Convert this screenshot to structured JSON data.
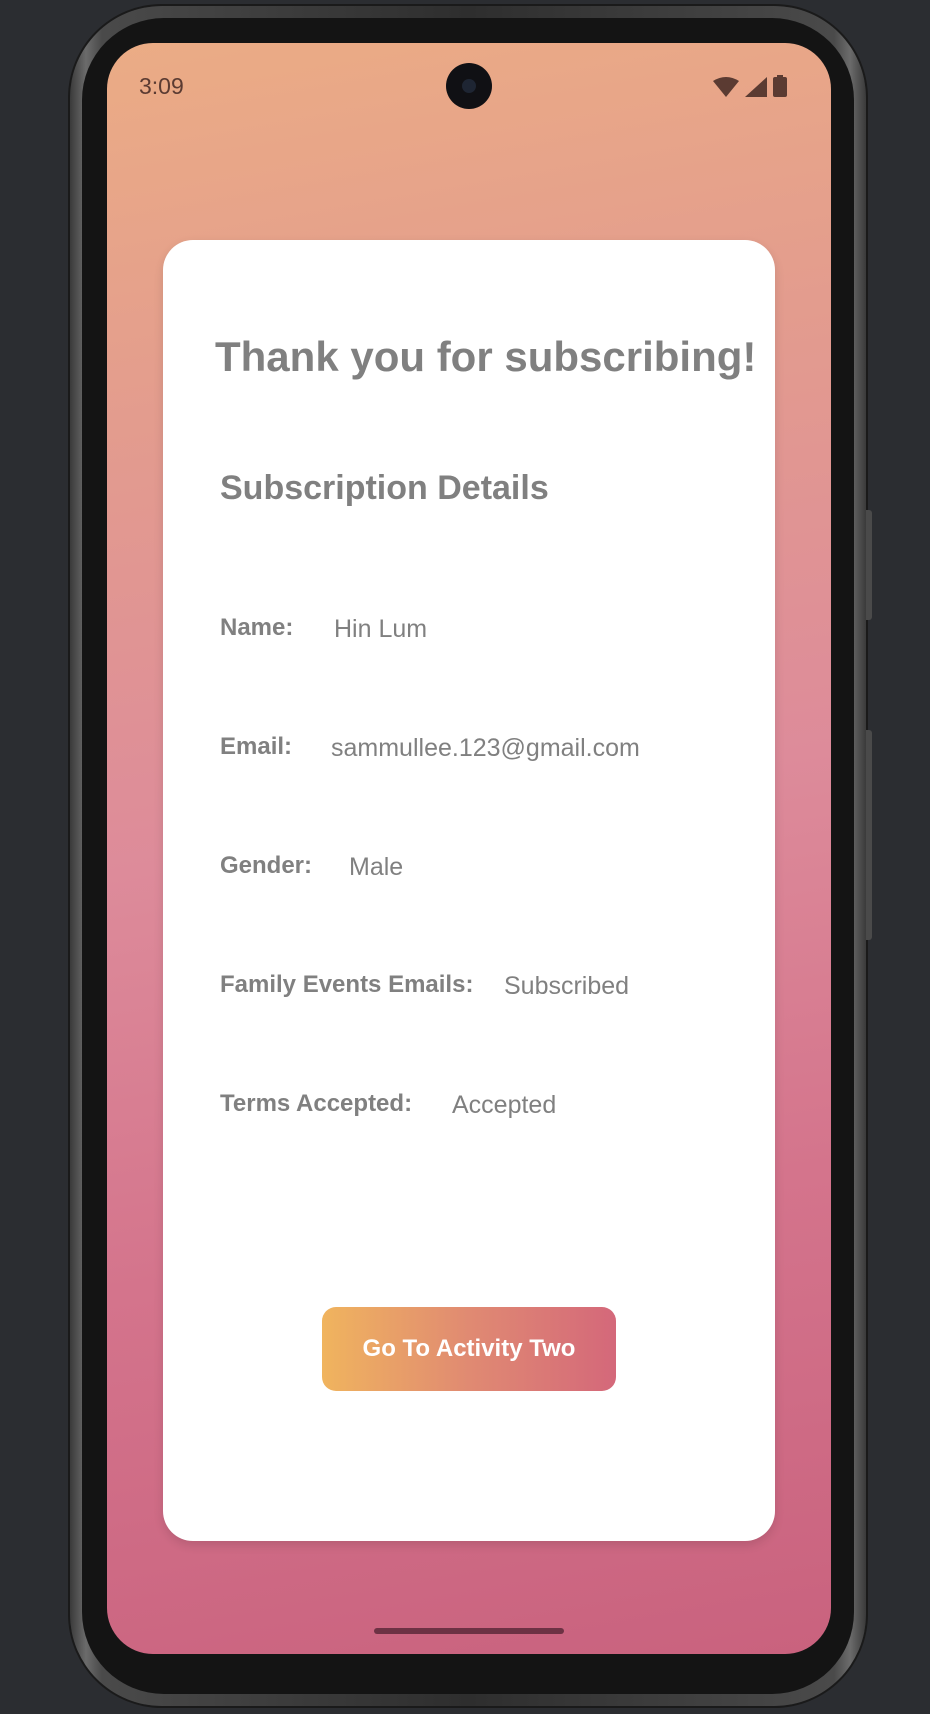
{
  "status_bar": {
    "time": "3:09",
    "icons": [
      "wifi-icon",
      "signal-icon",
      "battery-icon"
    ]
  },
  "card": {
    "title": "Thank you for subscribing!",
    "subtitle": "Subscription Details",
    "rows": [
      {
        "label": "Name:",
        "value": "Hin Lum"
      },
      {
        "label": "Email:",
        "value": "sammullee.123@gmail.com"
      },
      {
        "label": "Gender:",
        "value": "Male"
      },
      {
        "label": "Family Events Emails:",
        "value": "Subscribed"
      },
      {
        "label": "Terms Accepted:",
        "value": "Accepted"
      }
    ],
    "button_label": "Go To Activity Two"
  },
  "colors": {
    "text_gray": "#808080",
    "button_gradient_start": "#f0b45e",
    "button_gradient_end": "#d4687a",
    "background_top": "#ebac85",
    "background_bottom": "#c9627e"
  }
}
